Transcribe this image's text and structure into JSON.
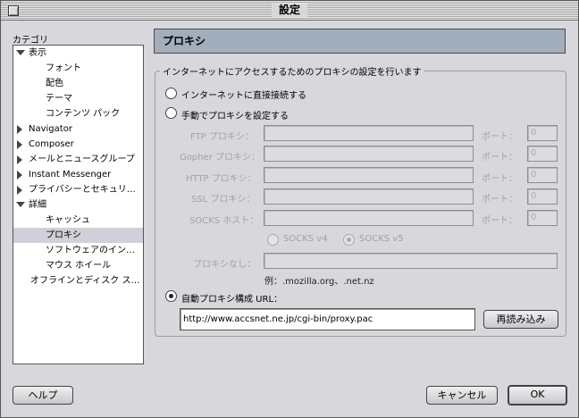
{
  "window": {
    "title": "設定"
  },
  "sidebar": {
    "label": "カテゴリ",
    "items": [
      {
        "label": "表示",
        "expander": "down"
      },
      {
        "label": "フォント",
        "expander": ""
      },
      {
        "label": "配色",
        "expander": ""
      },
      {
        "label": "テーマ",
        "expander": ""
      },
      {
        "label": "コンテンツ パック",
        "expander": ""
      },
      {
        "label": "Navigator",
        "expander": "right"
      },
      {
        "label": "Composer",
        "expander": "right"
      },
      {
        "label": "メールとニュースグループ",
        "expander": "right"
      },
      {
        "label": "Instant Messenger",
        "expander": "right"
      },
      {
        "label": "プライバシーとセキュリ…",
        "expander": "right"
      },
      {
        "label": "詳細",
        "expander": "down"
      },
      {
        "label": "キャッシュ",
        "expander": ""
      },
      {
        "label": "プロキシ",
        "expander": "",
        "selected": true
      },
      {
        "label": "ソフトウェアのイン…",
        "expander": ""
      },
      {
        "label": "マウス ホイール",
        "expander": ""
      },
      {
        "label": "オフラインとディスク ス…",
        "expander": ""
      }
    ]
  },
  "panel": {
    "title": "プロキシ",
    "group_label": "インターネットにアクセスするためのプロキシの設定を行います",
    "radio_direct": "インターネットに直接接続する",
    "radio_manual": "手動でプロキシを設定する",
    "radio_auto": "自動プロキシ構成 URL：",
    "port_label": "ポート：",
    "proxies": [
      {
        "label": "FTP プロキシ：",
        "port_placeholder": "0"
      },
      {
        "label": "Gopher プロキシ：",
        "port_placeholder": "0"
      },
      {
        "label": "HTTP プロキシ：",
        "port_placeholder": "0"
      },
      {
        "label": "SSL プロキシ：",
        "port_placeholder": "0"
      },
      {
        "label": "SOCKS ホスト：",
        "port_placeholder": "0"
      }
    ],
    "socks_v4": "SOCKS v4",
    "socks_v5": "SOCKS v5",
    "no_proxy_label": "プロキシなし：",
    "no_proxy_example": "例：.mozilla.org、.net.nz",
    "auto_url_value": "http://www.accsnet.ne.jp/cgi-bin/proxy.pac",
    "reload_button": "再読み込み"
  },
  "footer": {
    "help_button": "ヘルプ",
    "cancel_button": "キャンセル",
    "ok_button": "OK"
  }
}
